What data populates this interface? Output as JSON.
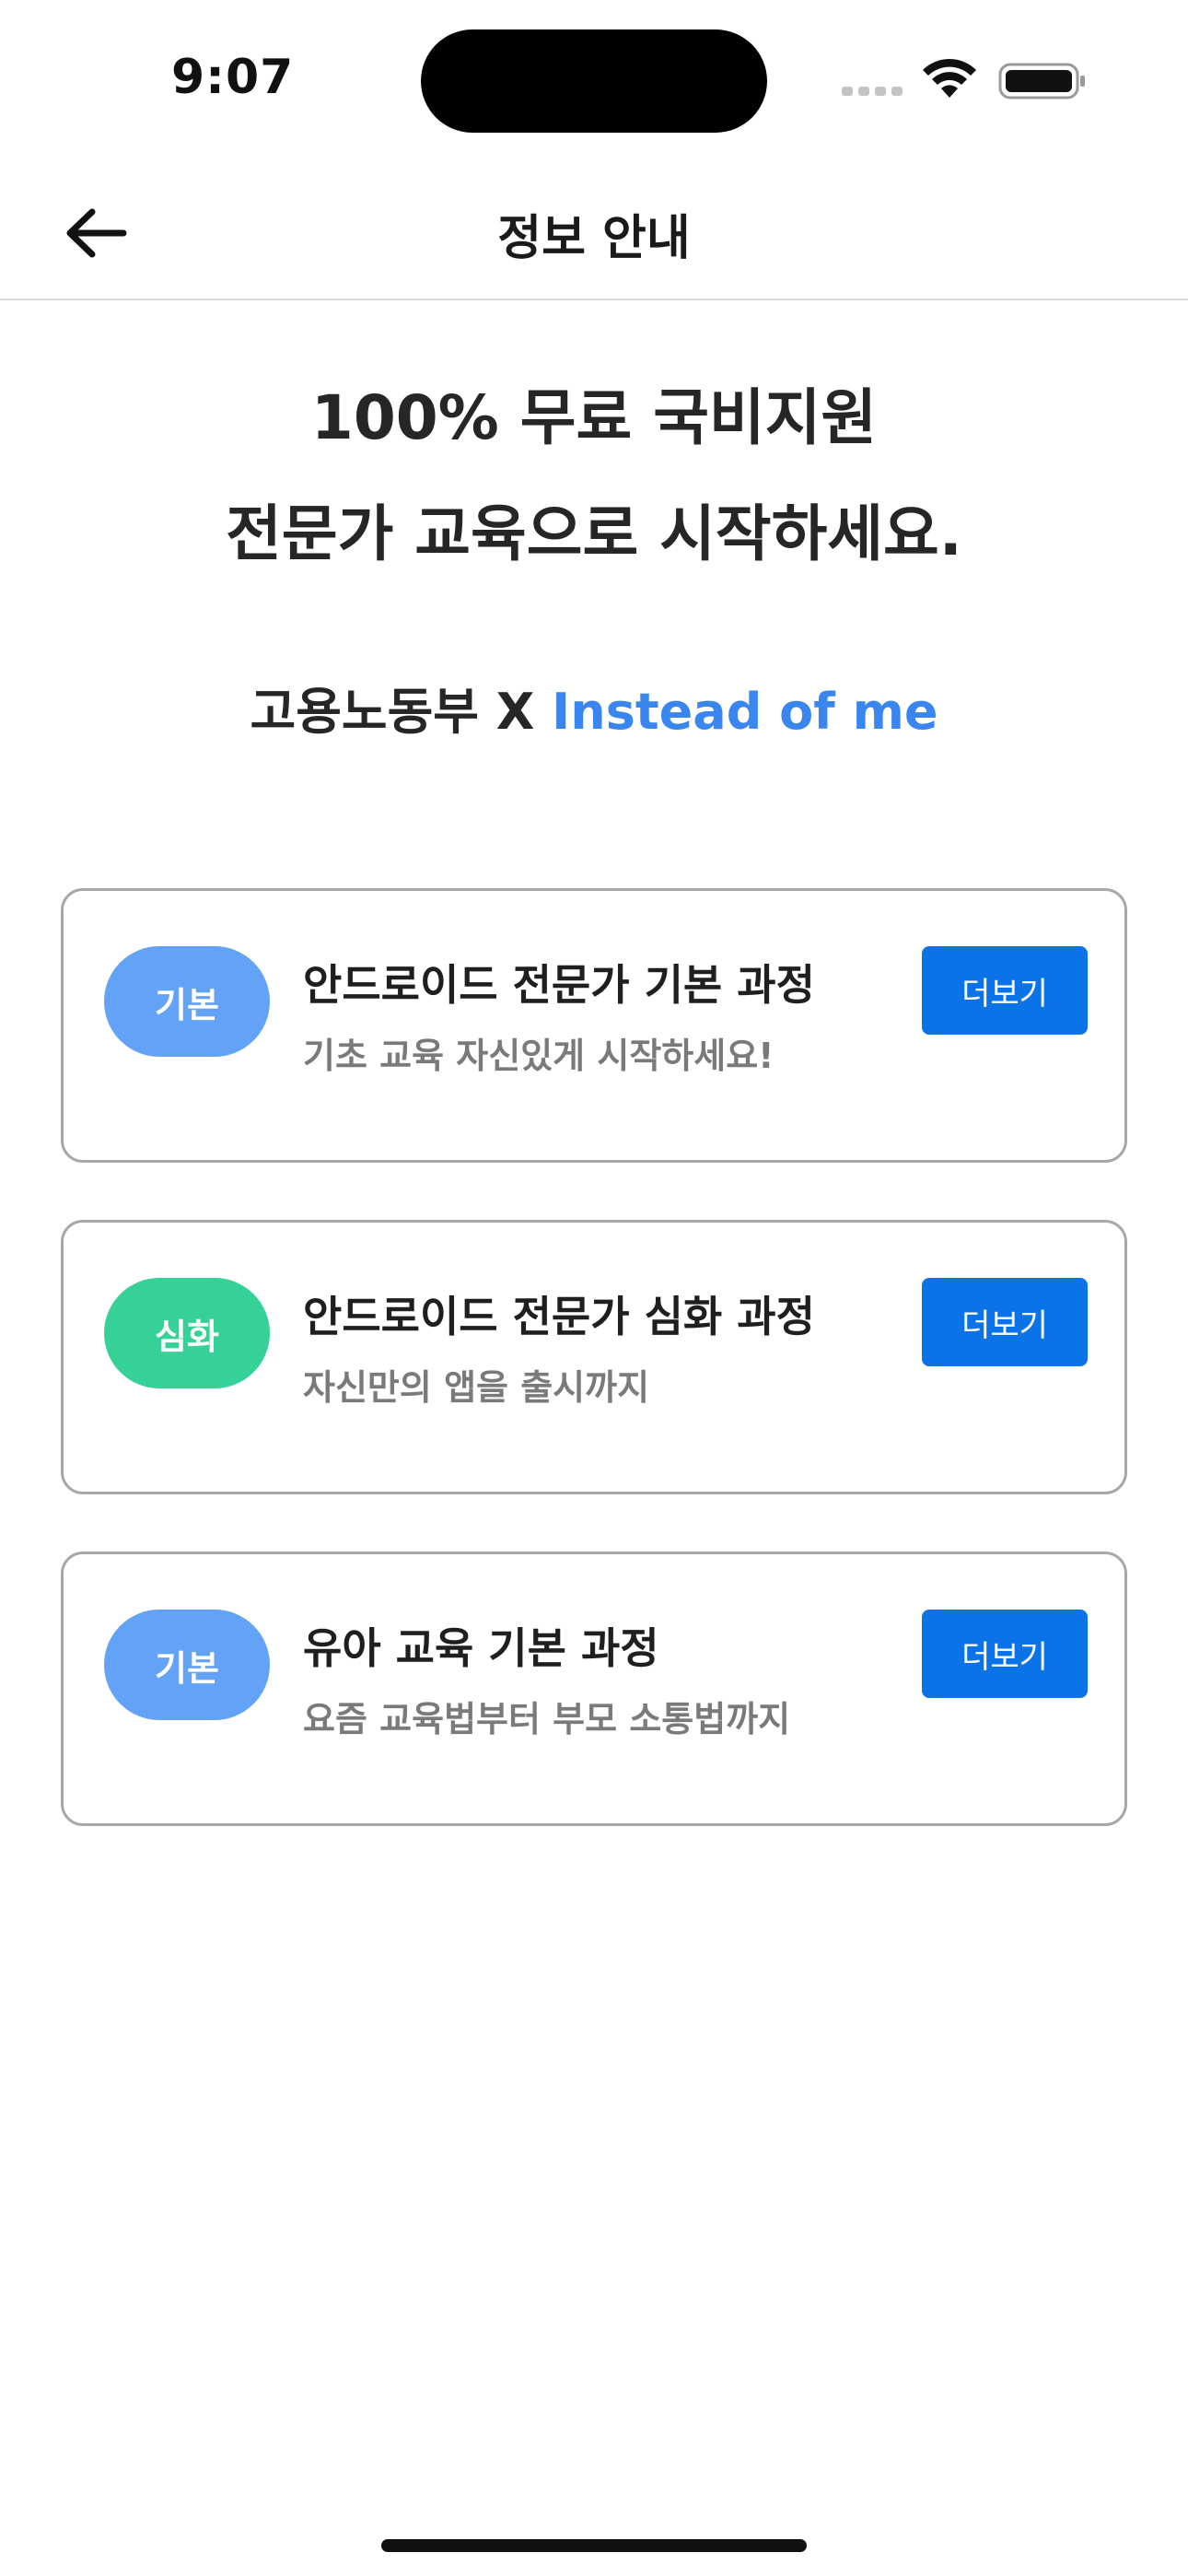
{
  "status_bar": {
    "time": "9:07",
    "icons": [
      "signal-icon",
      "wifi-icon",
      "battery-icon"
    ]
  },
  "nav": {
    "back_icon": "arrow-left-icon",
    "title": "정보 안내"
  },
  "hero": {
    "line1": "100% 무료 국비지원",
    "line2": "전문가 교육으로 시작하세요."
  },
  "partner": {
    "ministry": "고용노동부 X ",
    "brand": "Instead of me",
    "brand_color": "#3a86f0"
  },
  "courses": [
    {
      "badge": "기본",
      "badge_color": "#62a2f7",
      "title": "안드로이드 전문가 기본 과정",
      "subtitle": "기초 교육 자신있게 시작하세요!",
      "button": "더보기"
    },
    {
      "badge": "심화",
      "badge_color": "#35d196",
      "title": "안드로이드 전문가 심화 과정",
      "subtitle": "자신만의 앱을 출시까지",
      "button": "더보기"
    },
    {
      "badge": "기본",
      "badge_color": "#62a2f7",
      "title": "유아 교육 기본 과정",
      "subtitle": "요즘 교육법부터 부모 소통법까지",
      "button": "더보기"
    }
  ],
  "colors": {
    "button_primary": "#0a73e8",
    "card_border": "#a8a8a8"
  }
}
